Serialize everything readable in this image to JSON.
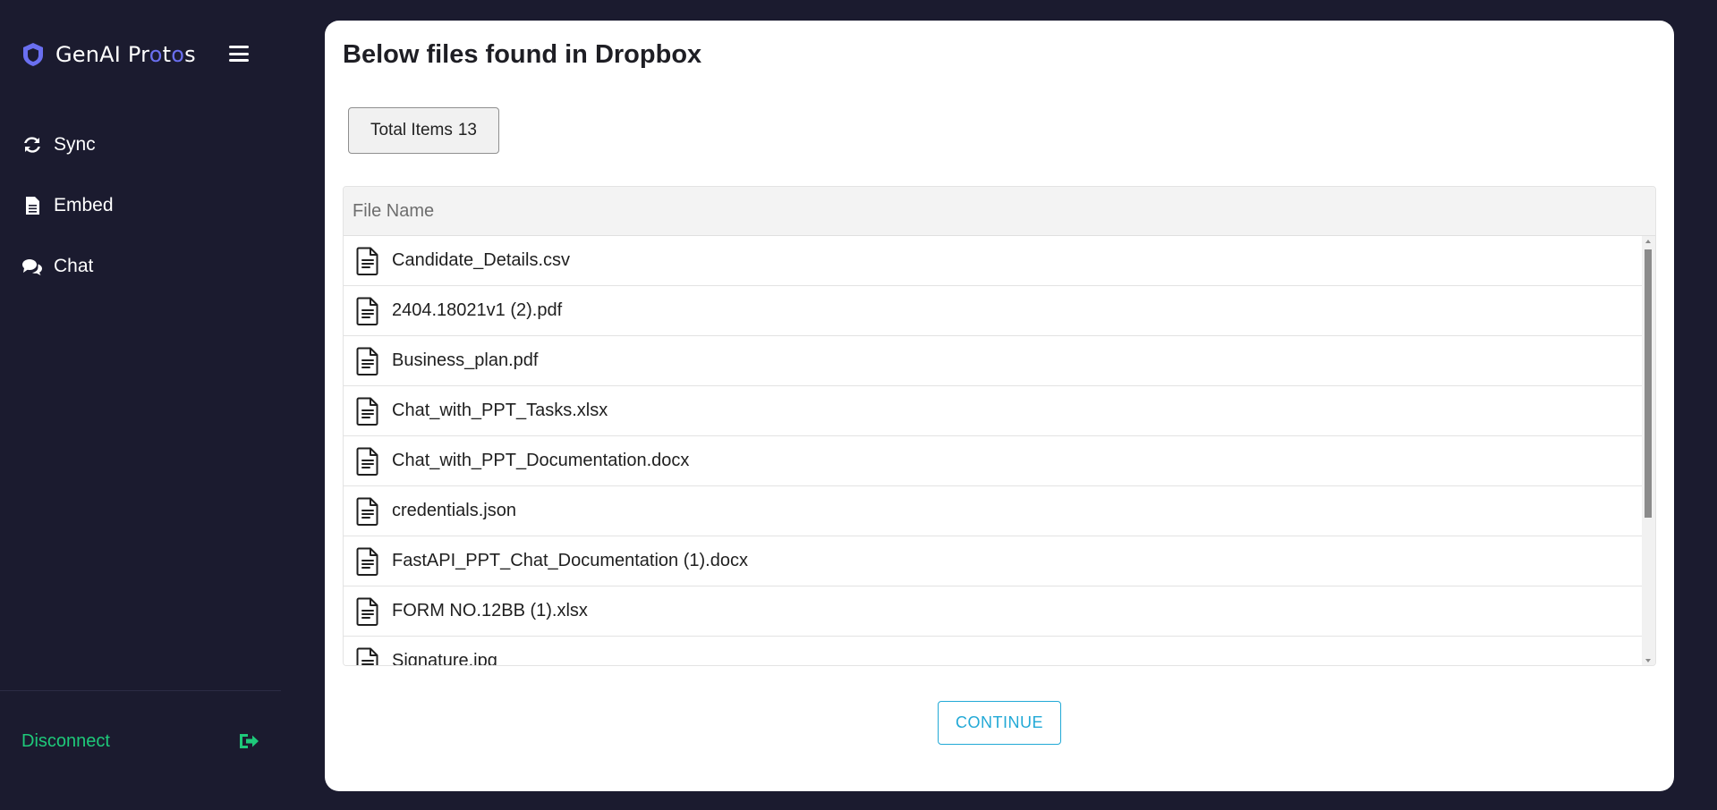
{
  "brand": {
    "name_part1": "GenAI Pr",
    "name_hl1": "o",
    "name_part2": "t",
    "name_hl2": "o",
    "name_part3": "s"
  },
  "sidebar": {
    "items": [
      {
        "label": "Sync",
        "icon": "sync-icon"
      },
      {
        "label": "Embed",
        "icon": "document-icon"
      },
      {
        "label": "Chat",
        "icon": "chat-icon"
      }
    ],
    "disconnect_label": "Disconnect"
  },
  "main": {
    "title": "Below files found in Dropbox",
    "total_label": "Total Items",
    "total_count": "13",
    "table": {
      "header": "File Name",
      "files": [
        "Candidate_Details.csv",
        "2404.18021v1 (2).pdf",
        "Business_plan.pdf",
        "Chat_with_PPT_Tasks.xlsx",
        "Chat_with_PPT_Documentation.docx",
        "credentials.json",
        "FastAPI_PPT_Chat_Documentation (1).docx",
        "FORM NO.12BB (1).xlsx",
        "Signature.jpg"
      ]
    },
    "continue_label": "CONTINUE"
  },
  "colors": {
    "background": "#1b1b2f",
    "accent_green": "#1ec97a",
    "accent_blue": "#22a9d6",
    "brand_highlight": "#6a6ff0"
  }
}
